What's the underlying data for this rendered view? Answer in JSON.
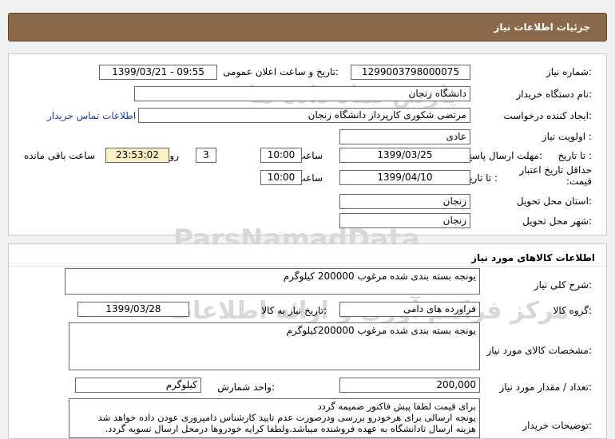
{
  "header": {
    "title": "جزئیات اطلاعات نیاز"
  },
  "need": {
    "number_label": "شماره نیاز:",
    "number_value": "1299003798000075",
    "announce_label": "تاریخ و ساعت اعلان عمومی:",
    "announce_value": "1399/03/21 - 09:55",
    "buyer_label": "نام دستگاه خریدار:",
    "buyer_value": "دانشگاه زنجان",
    "creator_label": "ایجاد کننده درخواست:",
    "creator_value": "مرتضی شکوری کارپرداز دانشگاه زنجان",
    "contact_link": "اطلاعات تماس خریدار",
    "priority_label": "اولویت نیاز :",
    "priority_value": "عادی",
    "deadline_label": "مهلت ارسال پاسخ:",
    "to_date_label": "تا تاریخ :",
    "deadline_date": "1399/03/25",
    "time_label": "ساعت",
    "deadline_time": "10:00",
    "days_value": "3",
    "days_label": "روز و",
    "remaining_time": "23:53:02",
    "remaining_label": "ساعت باقی مانده",
    "validity_label": "حداقل تاریخ اعتبار قیمت:",
    "validity_date": "1399/04/10",
    "validity_time": "10:00",
    "province_label": "استان محل تحویل:",
    "province_value": "زنجان",
    "city_label": "شهر محل تحویل:",
    "city_value": "زنجان"
  },
  "goods": {
    "section_title": "اطلاعات کالاهای مورد نیاز",
    "summary_label": "شرح کلی نیاز:",
    "summary_value": "یونجه بسته بندی شده مرغوب  200000 کیلوگرم",
    "group_label": "گروه کالا:",
    "group_value": "فراورده های دامی",
    "need_date_label": "تاریخ نیاز به کالا:",
    "need_date_value": "1399/03/28",
    "spec_label": "مشخصات کالای مورد نیاز:",
    "spec_value": "یونجه بسته بندی شده مرغوب 200000کیلوگرم",
    "qty_label": "تعداد / مقدار مورد نیاز:",
    "qty_value": "200,000",
    "unit_label": "واحد شمارش:",
    "unit_value": "کیلوگرم",
    "notes_label": "توضیحات خریدار:",
    "notes_lines": [
      "برای قیمت لطفا پیش فاکتور ضمیمه گردد",
      "یونجه ارسالی برای هرخودرو بررسی ودرصورت عدم تایید کارشناس دامپروری عودن داده خواهد شد",
      "هزینه ارسال تادانشگاه به عهده فروشنده میباشد.ولطفا کرایه خودروها درمحل ارسال تسویه گردد."
    ]
  },
  "watermark": {
    "brand": "ParsNamadData",
    "fa_name": "پارس نماد داده ها",
    "fa_tagline": "مرکز فراهم آوری و ارائه اطلاعات",
    "phone": "۰۲۱-۸۸۳۴۹۶۷۰-۵"
  }
}
